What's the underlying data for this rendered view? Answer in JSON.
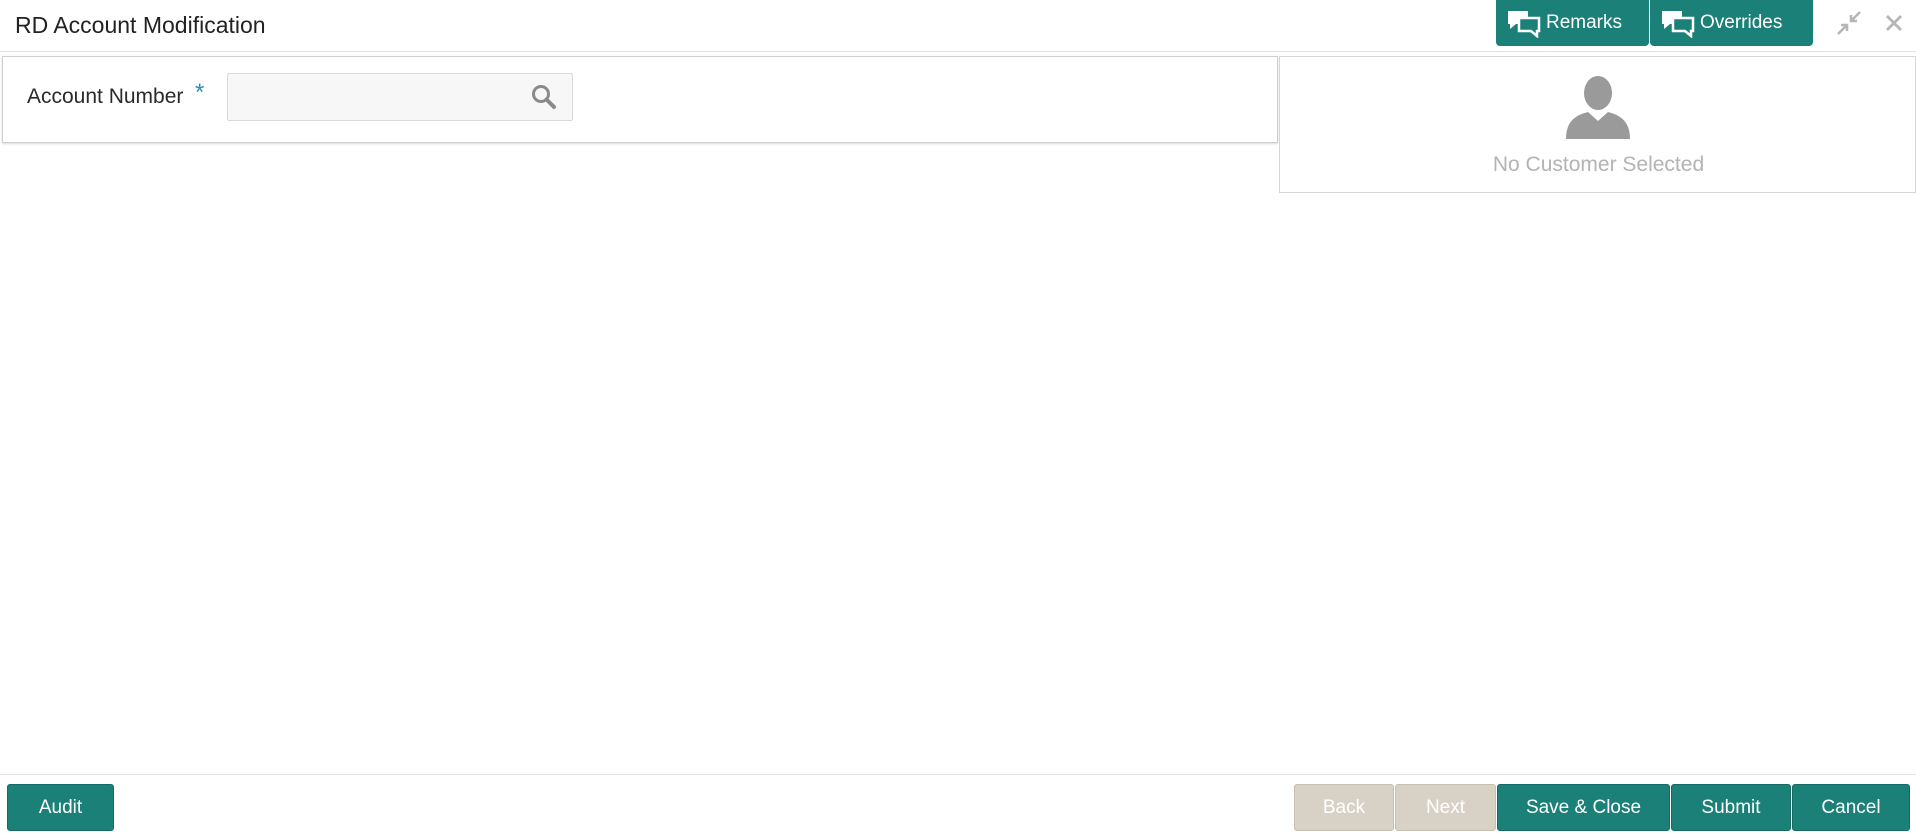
{
  "header": {
    "title": "RD Account Modification",
    "remarks_label": "Remarks",
    "overrides_label": "Overrides"
  },
  "account": {
    "label": "Account Number",
    "required_marker": "*",
    "value": ""
  },
  "customer": {
    "empty_text": "No Customer Selected"
  },
  "footer": {
    "audit_label": "Audit",
    "back_label": "Back",
    "next_label": "Next",
    "save_close_label": "Save & Close",
    "submit_label": "Submit",
    "cancel_label": "Cancel"
  },
  "colors": {
    "accent": "#1b8078",
    "disabled_button": "#d8d2c6",
    "required_marker": "#2f8ab8",
    "placeholder_text": "#b3b3b3"
  },
  "icons": {
    "remarks": "chat-bubbles-icon",
    "overrides": "chat-bubbles-icon",
    "minimize": "minimize-icon",
    "close": "close-icon",
    "search": "search-icon",
    "avatar": "person-icon"
  }
}
